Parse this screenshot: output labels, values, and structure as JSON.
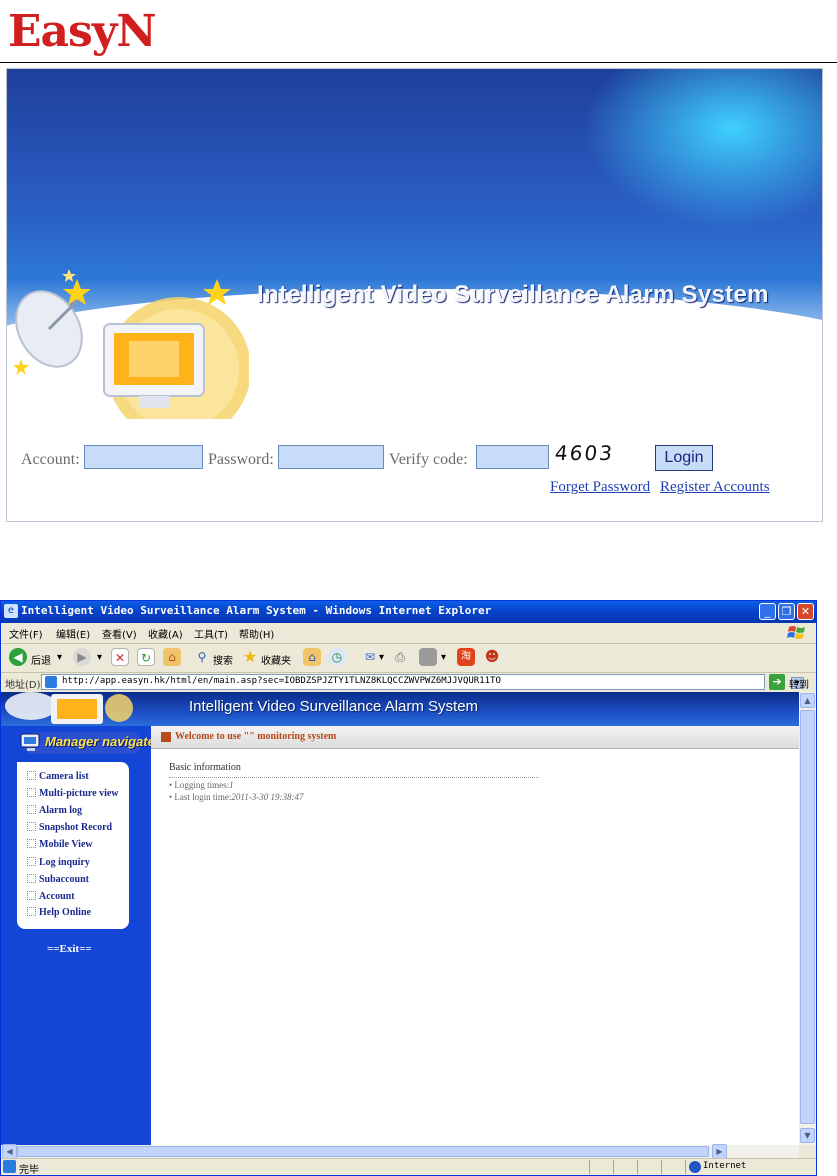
{
  "header": {
    "logo": "EasyN"
  },
  "login_page": {
    "title": "Intelligent Video Surveillance Alarm System",
    "account_label": "Account:",
    "account_value": "",
    "password_label": "Password:",
    "password_value": "",
    "verify_label": "Verify code:",
    "verify_value": "",
    "verify_code": "4603",
    "login_button": "Login",
    "forget_password": "Forget Password",
    "register_accounts": "Register Accounts"
  },
  "browser": {
    "window_title": "Intelligent Video Surveillance Alarm System - Windows Internet Explorer",
    "menu": [
      "文件(F)",
      "编辑(E)",
      "查看(V)",
      "收藏(A)",
      "工具(T)",
      "帮助(H)"
    ],
    "toolbar": {
      "back": "后退",
      "search": "搜索",
      "favorites": "收藏夹"
    },
    "address_label": "地址(D)",
    "address_url": "http://app.easyn.hk/html/en/main.asp?sec=IOBDZSPJZTY1TLNZ8KLQCCZWVPWZ6MJJVQUR11TO",
    "go_label": "转到",
    "status_text": "完毕",
    "status_zone": "Internet"
  },
  "app": {
    "header_title": "Intelligent Video Surveillance Alarm System",
    "manager_navigate": "Manager navigate",
    "nav_items": [
      "Camera list",
      "Multi-picture view",
      "Alarm log",
      "Snapshot Record",
      "Mobile View",
      "Log inquiry",
      "Subaccount",
      "Account",
      "Help Online"
    ],
    "exit": "==Exit==",
    "welcome": "Welcome to use \"\" monitoring system",
    "basic_information": "Basic information",
    "logging_times_label": "• Logging times:",
    "logging_times_value": "1",
    "last_login_label": "• Last login time:",
    "last_login_value": "2011-3-30 19:38:47"
  },
  "colors": {
    "logo_red": "#d11f1f",
    "sidebar_blue": "#1346d6",
    "welcome_orange": "#b84817",
    "link_blue": "#1f3fb5"
  }
}
